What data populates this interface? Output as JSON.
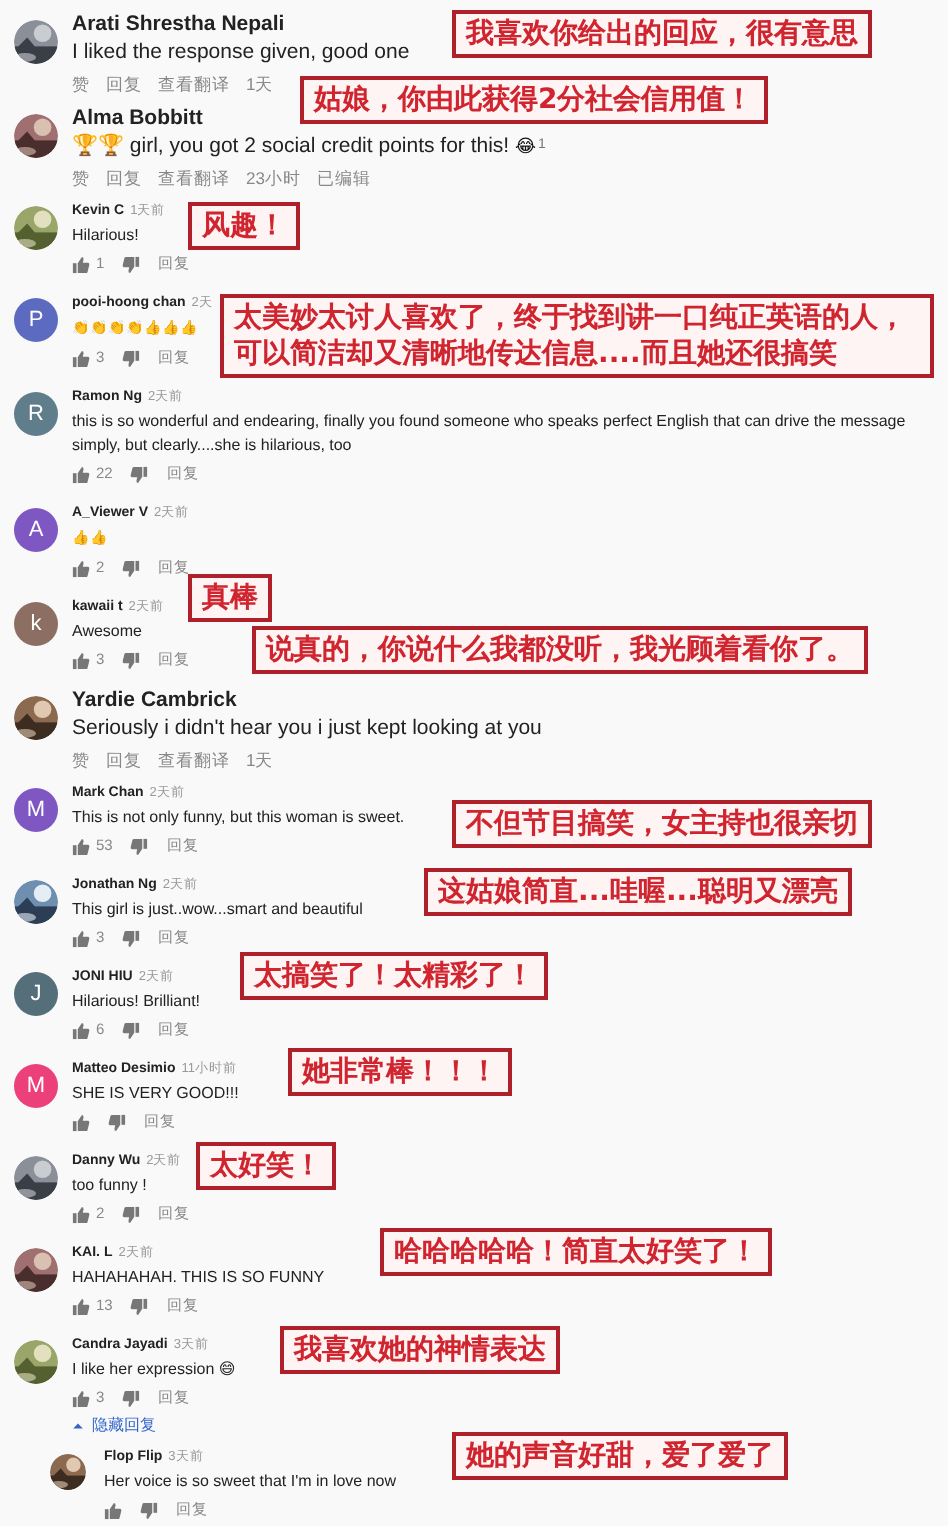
{
  "comments": [
    {
      "kind": "large",
      "author": "Arati Shrestha Nepali",
      "text": "I liked the response given, good one",
      "actions": [
        "赞",
        "回复",
        "查看翻译"
      ],
      "time": "1天",
      "annotation": "我喜欢你给出的回应，很有意思"
    },
    {
      "kind": "large",
      "author": "Alma Bobbitt",
      "text": "🏆🏆 girl, you got 2 social credit points for this!",
      "reaction": "😂",
      "reaction_count": "1",
      "actions": [
        "赞",
        "回复",
        "查看翻译"
      ],
      "time": "23小时",
      "edited": "已编辑",
      "annotation": "姑娘，你由此获得2分社会信用值！"
    },
    {
      "kind": "small",
      "author": "Kevin C",
      "time": "1天前",
      "text": "Hilarious!",
      "likes": "1",
      "reply": "回复",
      "annotation": "风趣！"
    },
    {
      "kind": "small",
      "author": "pooi-hoong chan",
      "avatar": {
        "kind": "letter",
        "letter": "P",
        "color": "#5c6bc0"
      },
      "time": "2天",
      "text": "👏👏👏👏👍👍👍",
      "likes": "3",
      "reply": "回复",
      "annotation": "太美妙太讨人喜欢了，终于找到讲一口纯正英语的人，可以简洁却又清晰地传达信息....而且她还很搞笑"
    },
    {
      "kind": "small",
      "author": "Ramon Ng",
      "avatar": {
        "kind": "letter",
        "letter": "R",
        "color": "#607d8b"
      },
      "time": "2天前",
      "text": "this is so wonderful and endearing, finally you found someone who speaks perfect English that can drive the message simply, but clearly....she is hilarious, too",
      "likes": "22",
      "reply": "回复"
    },
    {
      "kind": "small",
      "author": "A_Viewer V",
      "avatar": {
        "kind": "letter",
        "letter": "A",
        "color": "#7e57c2"
      },
      "time": "2天前",
      "text": "👍👍",
      "likes": "2",
      "reply": "回复"
    },
    {
      "kind": "small",
      "author": "kawaii t",
      "avatar": {
        "kind": "letter",
        "letter": "k",
        "color": "#8d6e63"
      },
      "time": "2天前",
      "text": "Awesome",
      "likes": "3",
      "reply": "回复",
      "annotation": "真棒"
    },
    {
      "kind": "large",
      "author": "Yardie Cambrick",
      "text": "Seriously i didn't hear you i just kept looking at you",
      "actions": [
        "赞",
        "回复",
        "查看翻译"
      ],
      "time": "1天",
      "annotation": "说真的，你说什么我都没听，我光顾着看你了。"
    },
    {
      "kind": "small",
      "author": "Mark Chan",
      "avatar": {
        "kind": "letter",
        "letter": "M",
        "color": "#7e57c2"
      },
      "time": "2天前",
      "text": "This is not only funny, but this woman is sweet.",
      "likes": "53",
      "reply": "回复",
      "annotation": "不但节目搞笑，女主持也很亲切"
    },
    {
      "kind": "small",
      "author": "Jonathan Ng",
      "time": "2天前",
      "text": "This girl is just..wow...smart and beautiful",
      "likes": "3",
      "reply": "回复",
      "annotation": "这姑娘简直...哇喔...聪明又漂亮"
    },
    {
      "kind": "small",
      "author": "JONI HIU",
      "avatar": {
        "kind": "letter",
        "letter": "J",
        "color": "#546e7a"
      },
      "time": "2天前",
      "text": "Hilarious! Brilliant!",
      "likes": "6",
      "reply": "回复",
      "annotation": "太搞笑了！太精彩了！"
    },
    {
      "kind": "small",
      "author": "Matteo Desimio",
      "avatar": {
        "kind": "letter",
        "letter": "M",
        "color": "#ec407a"
      },
      "time": "11小时前",
      "text": "SHE IS VERY GOOD!!!",
      "reply": "回复",
      "annotation": "她非常棒！！！"
    },
    {
      "kind": "small",
      "author": "Danny Wu",
      "time": "2天前",
      "text": "too funny !",
      "likes": "2",
      "reply": "回复",
      "annotation": "太好笑！"
    },
    {
      "kind": "small",
      "author": "KAI. L",
      "time": "2天前",
      "text": "HAHAHAHAH. THIS IS SO FUNNY",
      "likes": "13",
      "reply": "回复",
      "annotation": "哈哈哈哈哈！简直太好笑了！"
    },
    {
      "kind": "small",
      "author": "Candra Jayadi",
      "time": "3天前",
      "text": "I like her expression 😄",
      "likes": "3",
      "reply": "回复",
      "annotation": "我喜欢她的神情表达",
      "replies_toggle": "隐藏回复",
      "expanded": true,
      "replies": [
        {
          "kind": "small",
          "author": "Flop Flip",
          "time": "3天前",
          "text": "Her voice is so sweet that I'm in love now",
          "reply": "回复",
          "annotation": "她的声音好甜，爱了爱了"
        }
      ]
    }
  ]
}
